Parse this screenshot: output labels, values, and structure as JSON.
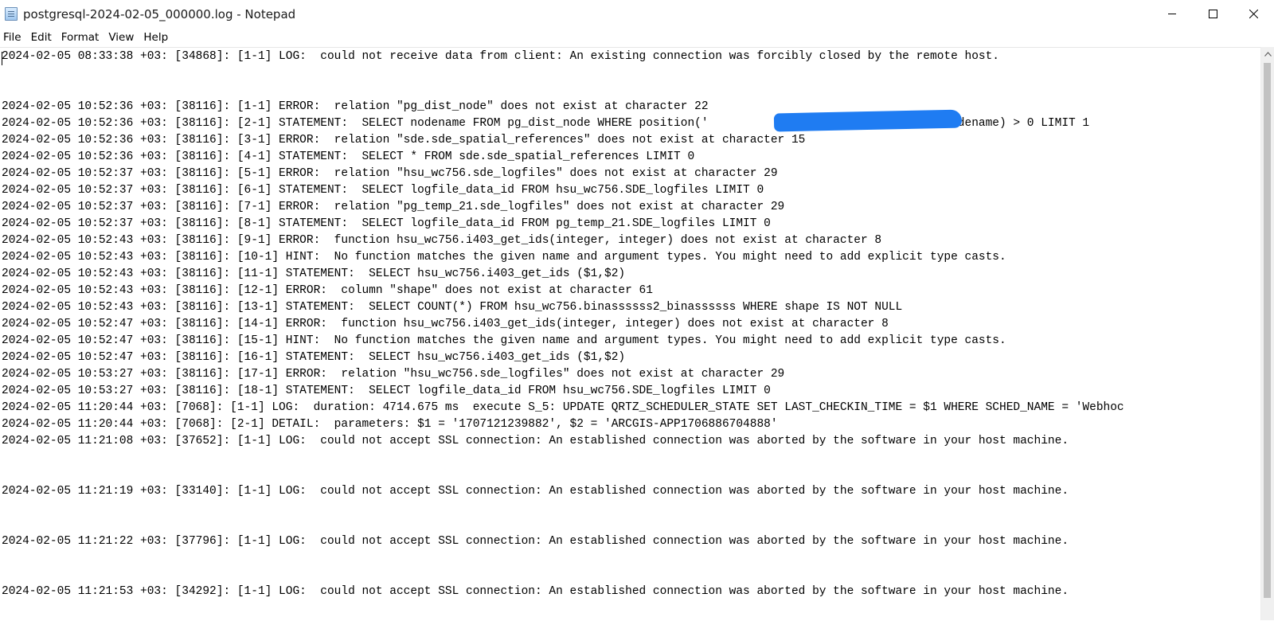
{
  "window": {
    "title": "postgresql-2024-02-05_000000.log - Notepad"
  },
  "menu": [
    "File",
    "Edit",
    "Format",
    "View",
    "Help"
  ],
  "editor": {
    "lines": [
      "2024-02-05 08:33:38 +03: [34868]: [1-1] LOG:  could not receive data from client: An existing connection was forcibly closed by the remote host.",
      "",
      "",
      "2024-02-05 10:52:36 +03: [38116]: [1-1] ERROR:  relation \"pg_dist_node\" does not exist at character 22",
      "2024-02-05 10:52:36 +03: [38116]: [2-1] STATEMENT:  SELECT nodename FROM pg_dist_node WHERE position('                             ' in nodename) > 0 LIMIT 1",
      "2024-02-05 10:52:36 +03: [38116]: [3-1] ERROR:  relation \"sde.sde_spatial_references\" does not exist at character 15",
      "2024-02-05 10:52:36 +03: [38116]: [4-1] STATEMENT:  SELECT * FROM sde.sde_spatial_references LIMIT 0",
      "2024-02-05 10:52:37 +03: [38116]: [5-1] ERROR:  relation \"hsu_wc756.sde_logfiles\" does not exist at character 29",
      "2024-02-05 10:52:37 +03: [38116]: [6-1] STATEMENT:  SELECT logfile_data_id FROM hsu_wc756.SDE_logfiles LIMIT 0",
      "2024-02-05 10:52:37 +03: [38116]: [7-1] ERROR:  relation \"pg_temp_21.sde_logfiles\" does not exist at character 29",
      "2024-02-05 10:52:37 +03: [38116]: [8-1] STATEMENT:  SELECT logfile_data_id FROM pg_temp_21.SDE_logfiles LIMIT 0",
      "2024-02-05 10:52:43 +03: [38116]: [9-1] ERROR:  function hsu_wc756.i403_get_ids(integer, integer) does not exist at character 8",
      "2024-02-05 10:52:43 +03: [38116]: [10-1] HINT:  No function matches the given name and argument types. You might need to add explicit type casts.",
      "2024-02-05 10:52:43 +03: [38116]: [11-1] STATEMENT:  SELECT hsu_wc756.i403_get_ids ($1,$2)",
      "2024-02-05 10:52:43 +03: [38116]: [12-1] ERROR:  column \"shape\" does not exist at character 61",
      "2024-02-05 10:52:43 +03: [38116]: [13-1] STATEMENT:  SELECT COUNT(*) FROM hsu_wc756.binassssss2_binassssss WHERE shape IS NOT NULL",
      "2024-02-05 10:52:47 +03: [38116]: [14-1] ERROR:  function hsu_wc756.i403_get_ids(integer, integer) does not exist at character 8",
      "2024-02-05 10:52:47 +03: [38116]: [15-1] HINT:  No function matches the given name and argument types. You might need to add explicit type casts.",
      "2024-02-05 10:52:47 +03: [38116]: [16-1] STATEMENT:  SELECT hsu_wc756.i403_get_ids ($1,$2)",
      "2024-02-05 10:53:27 +03: [38116]: [17-1] ERROR:  relation \"hsu_wc756.sde_logfiles\" does not exist at character 29",
      "2024-02-05 10:53:27 +03: [38116]: [18-1] STATEMENT:  SELECT logfile_data_id FROM hsu_wc756.SDE_logfiles LIMIT 0",
      "2024-02-05 11:20:44 +03: [7068]: [1-1] LOG:  duration: 4714.675 ms  execute S_5: UPDATE QRTZ_SCHEDULER_STATE SET LAST_CHECKIN_TIME = $1 WHERE SCHED_NAME = 'Webhoc",
      "2024-02-05 11:20:44 +03: [7068]: [2-1] DETAIL:  parameters: $1 = '1707121239882', $2 = 'ARCGIS-APP1706886704888'",
      "2024-02-05 11:21:08 +03: [37652]: [1-1] LOG:  could not accept SSL connection: An established connection was aborted by the software in your host machine.",
      "",
      "",
      "2024-02-05 11:21:19 +03: [33140]: [1-1] LOG:  could not accept SSL connection: An established connection was aborted by the software in your host machine.",
      "",
      "",
      "2024-02-05 11:21:22 +03: [37796]: [1-1] LOG:  could not accept SSL connection: An established connection was aborted by the software in your host machine.",
      "",
      "",
      "2024-02-05 11:21:53 +03: [34292]: [1-1] LOG:  could not accept SSL connection: An established connection was aborted by the software in your host machine."
    ]
  },
  "colors": {
    "redaction": "#1f7cf2",
    "scroll_thumb": "#c2c2c2"
  },
  "icons": {
    "app": "notepad-icon",
    "minimize": "minimize-icon",
    "maximize": "maximize-icon",
    "close": "close-icon",
    "scroll_up": "chevron-up-icon"
  }
}
